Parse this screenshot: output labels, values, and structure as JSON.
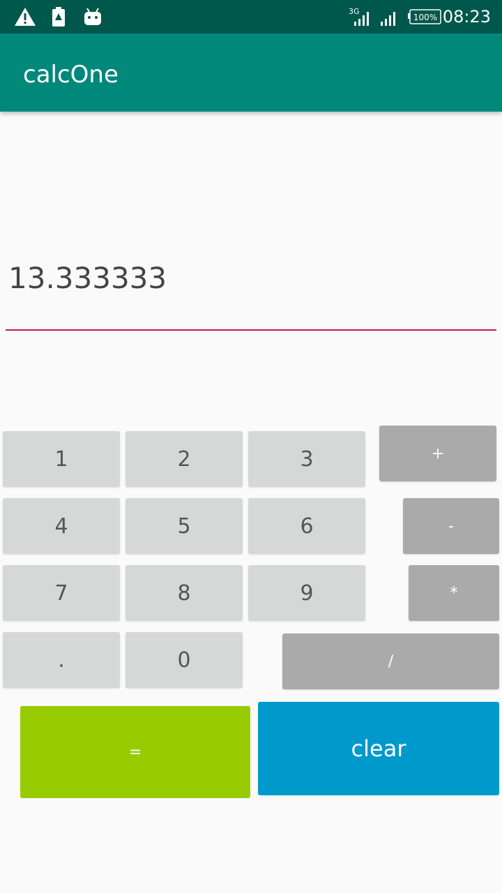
{
  "status_bar": {
    "time": "08:23",
    "battery": "100%",
    "network": "3G",
    "icons": [
      "warning-icon",
      "battery-alert-icon",
      "android-icon",
      "signal-3g-icon",
      "signal-icon",
      "battery-icon"
    ]
  },
  "app": {
    "title": "calcOne"
  },
  "display": {
    "value": "13.333333"
  },
  "keys": {
    "one": "1",
    "two": "2",
    "three": "3",
    "four": "4",
    "five": "5",
    "six": "6",
    "seven": "7",
    "eight": "8",
    "nine": "9",
    "dot": ".",
    "zero": "0",
    "plus": "+",
    "minus": "-",
    "multiply": "*",
    "divide": "/",
    "equals": "=",
    "clear": "clear"
  },
  "colors": {
    "status_bar": "#00574b",
    "app_bar": "#00897b",
    "underline": "#c2185b",
    "number_key": "#d6d7d7",
    "operator_key": "#aaaaaa",
    "equals_key": "#99cc00",
    "clear_key": "#0099cc"
  }
}
